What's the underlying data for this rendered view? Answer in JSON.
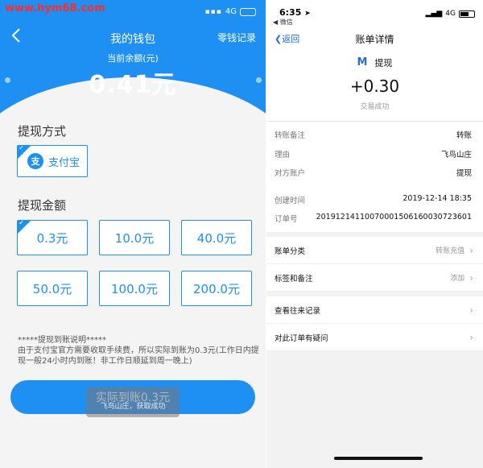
{
  "watermark": "www.hym68.com",
  "left": {
    "status": {
      "network": "4G"
    },
    "header": {
      "title": "我的钱包",
      "records_link": "零钱记录",
      "balance_label": "当前余额(元)",
      "balance_value": "0.41元"
    },
    "method": {
      "label": "提现方式",
      "option": "支付宝",
      "option_icon_glyph": "支"
    },
    "amount": {
      "label": "提现金额",
      "options": [
        "0.3元",
        "10.0元",
        "40.0元",
        "50.0元",
        "100.0元",
        "200.0元"
      ],
      "selected_index": 0
    },
    "note": {
      "title": "*****提现到账说明*****",
      "body": "由于支付宝官方需要收取手续费，所以实际到账为0.3元(工作日内提现一般24小时内到账！非工作日顺延到周一晚上)"
    },
    "cta_label": "实际到账0.3元",
    "toast": "飞鸟山庄，获取成功"
  },
  "right": {
    "status": {
      "time": "6:35",
      "back_app": "◀ 微信",
      "network": "4G"
    },
    "nav": {
      "back_label": "返回",
      "title": "账单详情"
    },
    "merchant": {
      "logo_glyph": "M",
      "name": "提现"
    },
    "amount": "+0.30",
    "status_text": "交易成功",
    "details": [
      {
        "k": "转账备注",
        "v": "转账"
      },
      {
        "k": "理由",
        "v": "飞鸟山庄"
      },
      {
        "k": "对方账户",
        "v": "提现"
      },
      {
        "k": "创建时间",
        "v": "2019-12-14 18:35"
      },
      {
        "k": "订单号",
        "v": "20191214110070001506160030723601"
      }
    ],
    "list1": [
      {
        "label": "账单分类",
        "value": "转账充值"
      },
      {
        "label": "标签和备注",
        "value": "添加"
      }
    ],
    "list2": [
      {
        "label": "查看往来记录",
        "value": ""
      },
      {
        "label": "对此订单有疑问",
        "value": ""
      }
    ]
  },
  "colors": {
    "primary": "#1e8ff3",
    "link": "#1e6fe6"
  }
}
